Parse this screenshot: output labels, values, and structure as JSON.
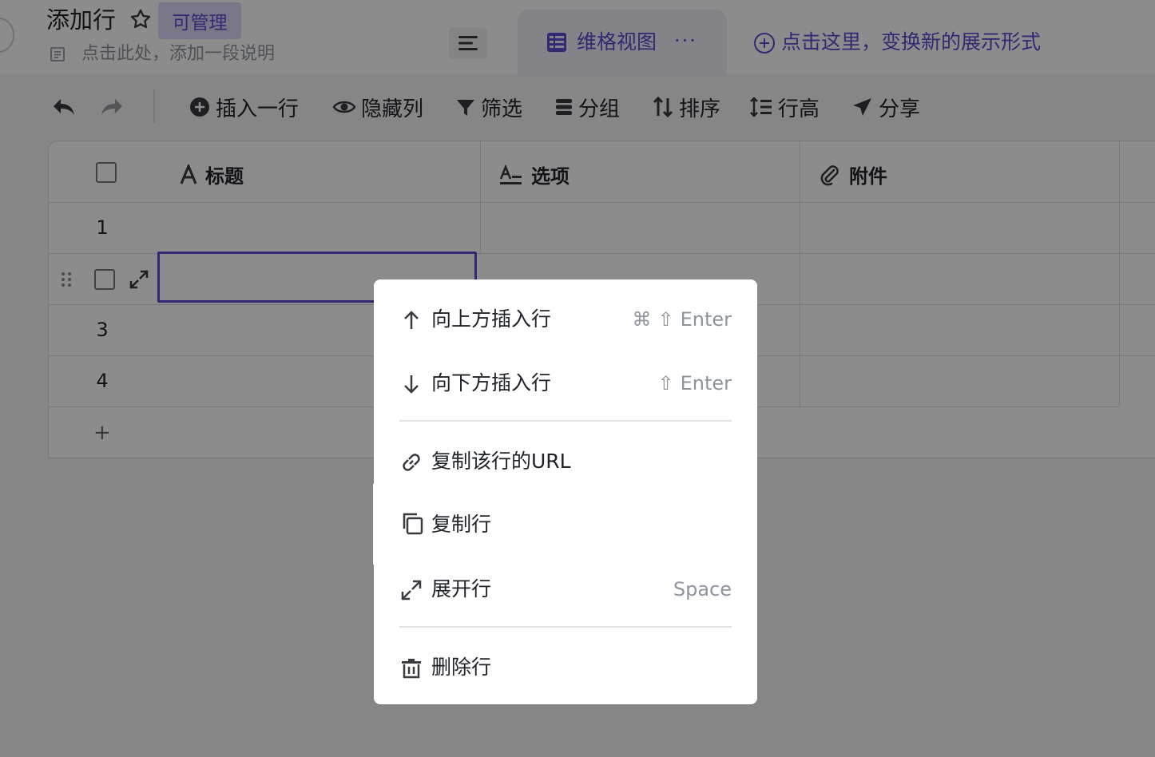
{
  "header": {
    "title": "添加行",
    "permission": "可管理",
    "description_placeholder": "点击此处，添加一段说明",
    "view_tab_label": "维格视图",
    "view_more": "···",
    "add_view_label": "点击这里，变换新的展示形式"
  },
  "toolbar": {
    "insert_row": "插入一行",
    "hide_columns": "隐藏列",
    "filter": "筛选",
    "group": "分组",
    "sort": "排序",
    "row_height": "行高",
    "share": "分享"
  },
  "table": {
    "columns": [
      {
        "label": "标题",
        "icon": "text-icon"
      },
      {
        "label": "选项",
        "icon": "select-icon"
      },
      {
        "label": "附件",
        "icon": "paperclip-icon"
      }
    ],
    "row_numbers": [
      "1",
      "3",
      "4"
    ],
    "add_row": "+"
  },
  "context_menu": {
    "items": [
      {
        "label": "向上方插入行",
        "shortcut_cmd": "⌘",
        "shortcut_shift": "⇧",
        "shortcut_key": "Enter"
      },
      {
        "label": "向下方插入行",
        "shortcut_shift": "⇧",
        "shortcut_key": "Enter"
      },
      {
        "label": "复制该行的URL"
      },
      {
        "label": "复制行"
      },
      {
        "label": "展开行",
        "shortcut_key": "Space"
      },
      {
        "label": "删除行"
      }
    ]
  },
  "colors": {
    "accent": "#5a4cd1",
    "badge_bg": "#ddd9f6"
  }
}
